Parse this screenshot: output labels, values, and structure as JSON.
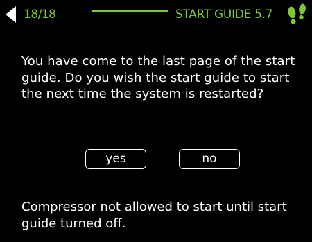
{
  "colors": {
    "accent": "#7dc832",
    "text": "#ffffff",
    "background": "#000000"
  },
  "header": {
    "back_icon": "triangle-left-icon",
    "page_indicator": "18/18",
    "title": "START GUIDE 5.7",
    "logo_icon": "footprints-icon"
  },
  "message": "You have come to the last page of the start guide. Do you wish the start guide to start the next time the system is restarted?",
  "buttons": {
    "yes_label": "yes",
    "no_label": "no"
  },
  "note": "Compressor not allowed to start until start guide turned off."
}
